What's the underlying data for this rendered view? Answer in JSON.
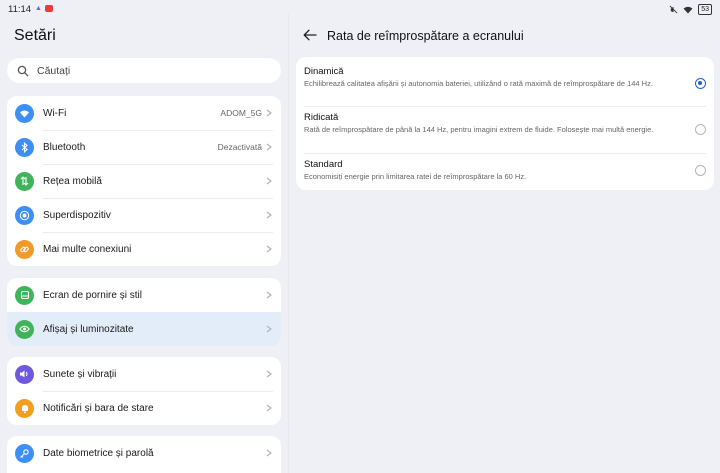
{
  "status": {
    "time": "11:14",
    "battery": "53"
  },
  "left": {
    "title": "Setări",
    "search_placeholder": "Căutați",
    "groups": [
      [
        {
          "label": "Wi-Fi",
          "value": "ADOM_5G",
          "icon": "wifi-icon",
          "color": "#3d8ef5"
        },
        {
          "label": "Bluetooth",
          "value": "Dezactivată",
          "icon": "bluetooth-icon",
          "color": "#3d8ef5"
        },
        {
          "label": "Rețea mobilă",
          "value": "",
          "icon": "mobile-network-icon",
          "color": "#42b35b"
        },
        {
          "label": "Superdispozitiv",
          "value": "",
          "icon": "superdevice-icon",
          "color": "#3d8ef5"
        },
        {
          "label": "Mai multe conexiuni",
          "value": "",
          "icon": "link-icon",
          "color": "#f09a2c"
        }
      ],
      [
        {
          "label": "Ecran de pornire și stil",
          "value": "",
          "icon": "home-screen-icon",
          "color": "#42b35b"
        },
        {
          "label": "Afișaj și luminozitate",
          "value": "",
          "icon": "eye-icon",
          "color": "#42b35b"
        }
      ],
      [
        {
          "label": "Sunete și vibrații",
          "value": "",
          "icon": "speaker-icon",
          "color": "#6e58e0"
        },
        {
          "label": "Notificări și bara de stare",
          "value": "",
          "icon": "bell-icon",
          "color": "#f0a020"
        }
      ],
      [
        {
          "label": "Date biometrice și parolă",
          "value": "",
          "icon": "key-icon",
          "color": "#3d8ef5"
        }
      ]
    ]
  },
  "right": {
    "title": "Rata de reîmprospătare a ecranului",
    "options": [
      {
        "title": "Dinamică",
        "desc": "Echilibrează calitatea afișării și autonomia bateriei, utilizând o rată maximă de reîmprospătare de 144 Hz.",
        "selected": true
      },
      {
        "title": "Ridicată",
        "desc": "Rată de reîmprospătare de până la 144 Hz, pentru imagini extrem de fluide. Folosește mai multă energie.",
        "selected": false
      },
      {
        "title": "Standard",
        "desc": "Economisiți energie prin limitarea ratei de reîmprospătare la 60 Hz.",
        "selected": false
      }
    ]
  },
  "colors": {
    "accent": "#1f5fd8",
    "selected_row": "#e3edfa",
    "background": "#eef0f5"
  }
}
